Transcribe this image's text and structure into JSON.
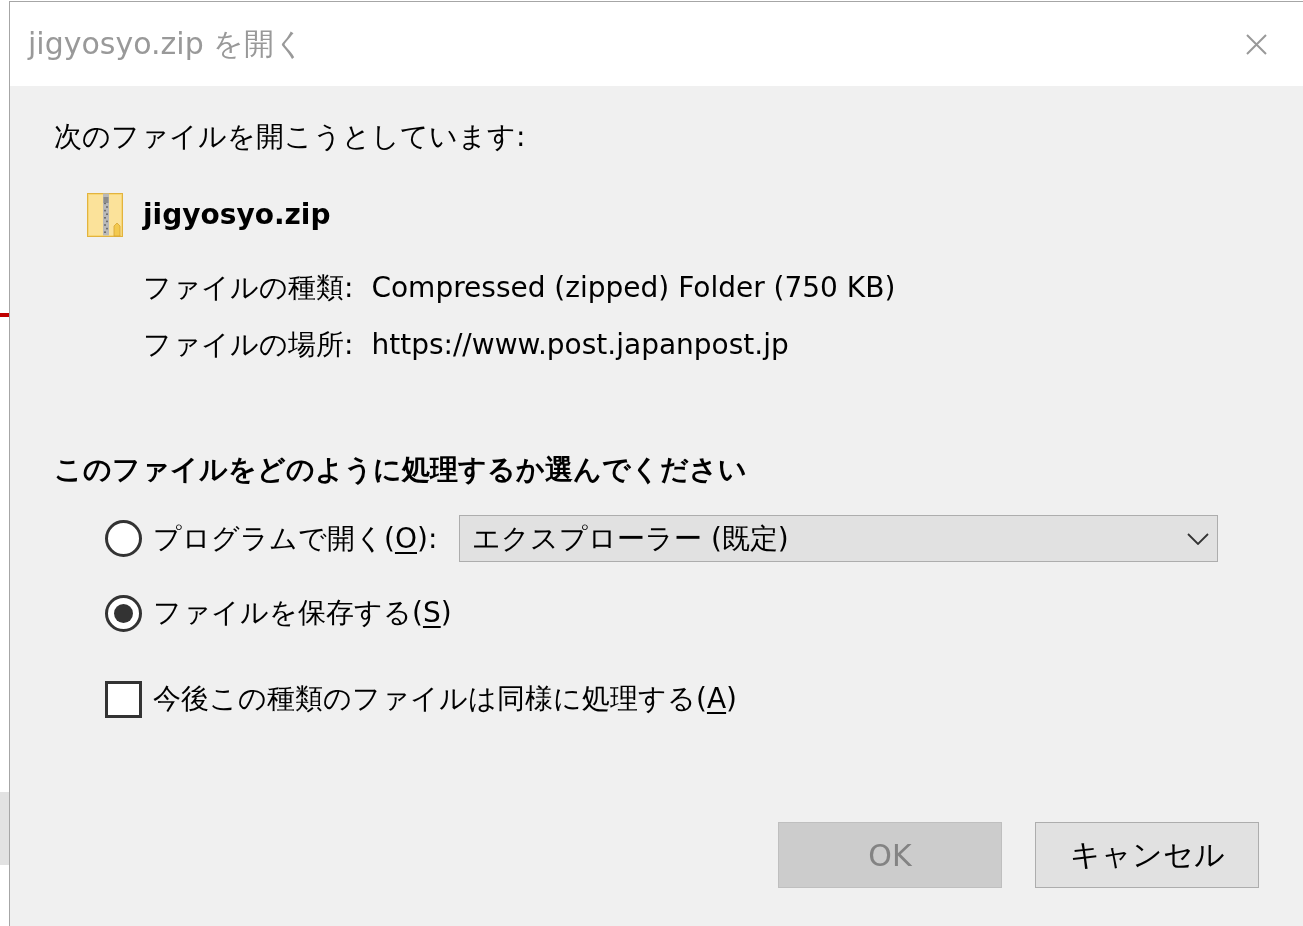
{
  "window": {
    "title": "jigyosyo.zip を開く"
  },
  "intro": "次のファイルを開こうとしています:",
  "file": {
    "name": "jigyosyo.zip",
    "details": [
      {
        "label": "ファイルの種類:",
        "value": "Compressed (zipped) Folder (750 KB)"
      },
      {
        "label": "ファイルの場所:",
        "value": "https://www.post.japanpost.jp"
      }
    ]
  },
  "question": "このファイルをどのように処理するか選んでください",
  "open_options": [
    {
      "text_before": "プログラムで開く(",
      "access_key": "O",
      "text_after": "):",
      "selected": false,
      "program": {
        "value": "エクスプローラー (既定)"
      }
    },
    {
      "text_before": "ファイルを保存する(",
      "access_key": "S",
      "text_after": ")",
      "selected": true
    }
  ],
  "remember": {
    "text_before": "今後この種類のファイルは同様に処理する(",
    "access_key": "A",
    "text_after": ")",
    "checked": false
  },
  "buttons": [
    {
      "label": "OK",
      "disabled": true
    },
    {
      "label": "キャンセル",
      "disabled": false
    }
  ]
}
